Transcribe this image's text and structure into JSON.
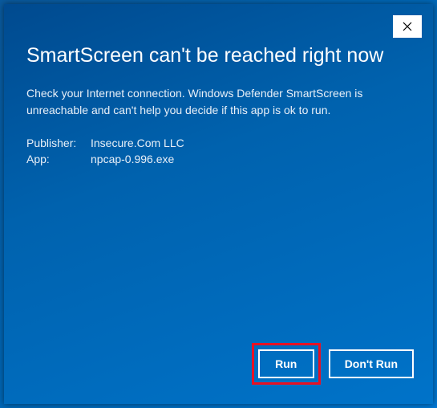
{
  "dialog": {
    "title": "SmartScreen can't be reached right now",
    "message": "Check your Internet connection. Windows Defender SmartScreen is unreachable and can't help you decide if this app is ok to run.",
    "publisher_label": "Publisher:",
    "publisher_value": "Insecure.Com LLC",
    "app_label": "App:",
    "app_value": "npcap-0.996.exe",
    "run_label": "Run",
    "dont_run_label": "Don't Run"
  }
}
